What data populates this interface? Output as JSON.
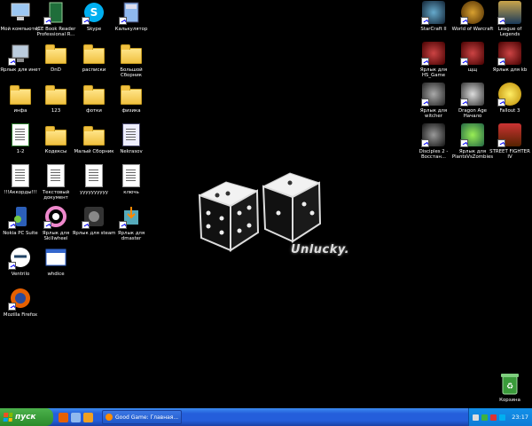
{
  "desktop": {
    "left_icons": [
      {
        "label": "Мой компьютер",
        "icon": "computer-icon"
      },
      {
        "label": "ICE Book Reader Professional R...",
        "icon": "book-icon",
        "shortcut": true
      },
      {
        "label": "Skype",
        "icon": "skype-icon",
        "shortcut": true
      },
      {
        "label": "Калькулятор",
        "icon": "calculator-icon",
        "shortcut": true
      },
      {
        "label": "Ярлык для инет",
        "icon": "network-icon",
        "shortcut": true
      },
      {
        "label": "DnD",
        "icon": "folder-icon"
      },
      {
        "label": "расписки",
        "icon": "folder-icon"
      },
      {
        "label": "Большой Сборник",
        "icon": "folder-icon"
      },
      {
        "label": "инфа",
        "icon": "folder-icon"
      },
      {
        "label": "123",
        "icon": "folder-icon"
      },
      {
        "label": "фотки",
        "icon": "folder-icon"
      },
      {
        "label": "физика",
        "icon": "folder-icon"
      },
      {
        "label": "1-2",
        "icon": "spreadsheet-icon"
      },
      {
        "label": "Кодексы",
        "icon": "folder-icon"
      },
      {
        "label": "Малый Сборник",
        "icon": "folder-icon"
      },
      {
        "label": "Nekrasov",
        "icon": "document-icon"
      },
      {
        "label": "!!!Аккорды!!!",
        "icon": "text-file-icon"
      },
      {
        "label": "Текстовый документ",
        "icon": "text-file-icon"
      },
      {
        "label": "yyyyyyyyyy",
        "icon": "text-file-icon"
      },
      {
        "label": "ключь",
        "icon": "text-file-icon"
      },
      {
        "label": "Nokia PC Suite",
        "icon": "nokia-icon",
        "shortcut": true
      },
      {
        "label": "Ярлык для Skillwheel",
        "icon": "skillwheel-icon",
        "shortcut": true
      },
      {
        "label": "Ярлык для steam",
        "icon": "steam-icon",
        "shortcut": true
      },
      {
        "label": "Ярлык для dmaster",
        "icon": "dmaster-icon",
        "shortcut": true
      },
      {
        "label": "Ventrilo",
        "icon": "ventrilo-icon",
        "shortcut": true
      },
      {
        "label": "whdice",
        "icon": "window-icon"
      },
      {
        "label": "Mozilla Firefox",
        "icon": "firefox-icon",
        "shortcut": true
      }
    ],
    "right_icons": [
      {
        "label": "StarCraft II",
        "icon": "starcraft-icon",
        "shortcut": true
      },
      {
        "label": "World of Warcraft",
        "icon": "warcraft-icon",
        "shortcut": true
      },
      {
        "label": "League of Legends",
        "icon": "lol-icon",
        "shortcut": true
      },
      {
        "label": "Ярлык для HS_Game",
        "icon": "game-icon",
        "shortcut": true
      },
      {
        "label": "щщ",
        "icon": "game-icon",
        "shortcut": true
      },
      {
        "label": "Ярлык для kb",
        "icon": "game-icon",
        "shortcut": true
      },
      {
        "label": "Ярлык для witcher",
        "icon": "witcher-icon",
        "shortcut": true
      },
      {
        "label": "Dragon Age Начало",
        "icon": "dragon-age-icon",
        "shortcut": true
      },
      {
        "label": "Fallout 3",
        "icon": "fallout-icon",
        "shortcut": true
      },
      {
        "label": "Disciples 2 - Восстан...",
        "icon": "disciples-icon",
        "shortcut": true
      },
      {
        "label": "Ярлык для PlantsVsZombies",
        "icon": "plants-icon",
        "shortcut": true
      },
      {
        "label": "STREET FIGHTER IV",
        "icon": "street-fighter-icon",
        "shortcut": true
      }
    ],
    "recycle_bin": {
      "label": "Корзина",
      "icon": "recycle-bin-icon"
    },
    "wallpaper_text": "Unlucky."
  },
  "taskbar": {
    "start_label": "пуск",
    "task_label": "Good Game: Главная...",
    "clock": "23:17"
  },
  "colors": {
    "taskbar": "#245edb",
    "start": "#2a8a2a",
    "tray": "#0f7bd6"
  }
}
